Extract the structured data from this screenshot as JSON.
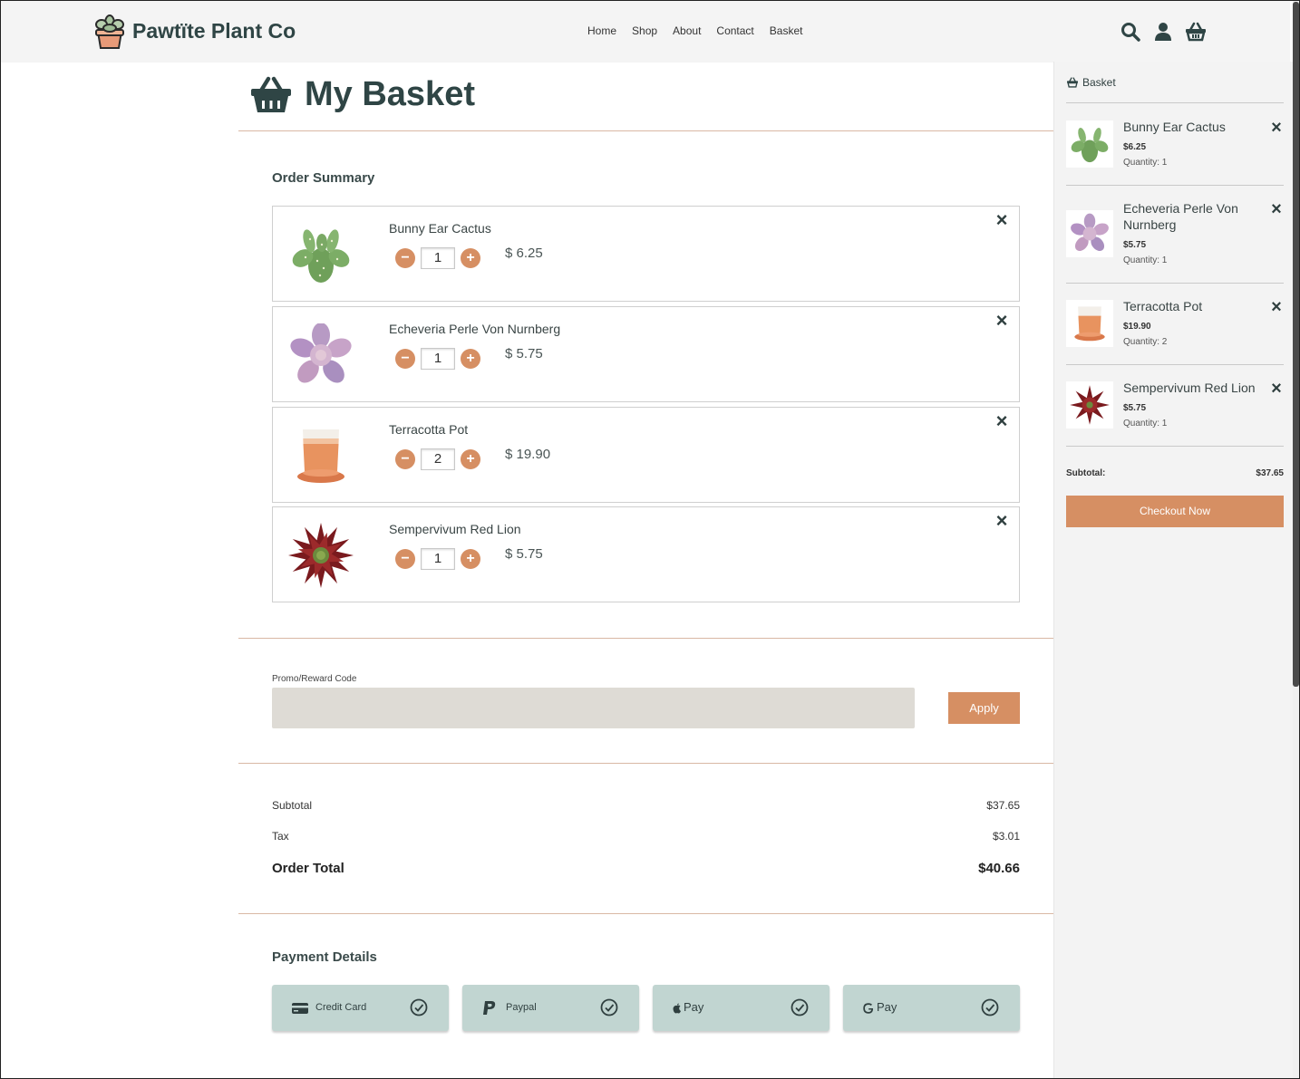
{
  "header": {
    "brand": "Pawtïte Plant Co",
    "nav": [
      "Home",
      "Shop",
      "About",
      "Contact",
      "Basket"
    ],
    "icons": [
      "search-icon",
      "user-icon",
      "basket-icon"
    ]
  },
  "page": {
    "title": "My Basket",
    "order_summary_title": "Order Summary"
  },
  "items": [
    {
      "name": "Bunny Ear Cactus",
      "qty": "1",
      "price": "$ 6.25",
      "image": "bunny-ear-cactus"
    },
    {
      "name": "Echeveria Perle Von Nurnberg",
      "qty": "1",
      "price": "$ 5.75",
      "image": "echeveria"
    },
    {
      "name": "Terracotta Pot",
      "qty": "2",
      "price": "$ 19.90",
      "image": "terracotta-pot"
    },
    {
      "name": "Sempervivum Red Lion",
      "qty": "1",
      "price": "$ 5.75",
      "image": "sempervivum"
    }
  ],
  "promo": {
    "label": "Promo/Reward Code",
    "value": "",
    "apply_label": "Apply"
  },
  "totals": {
    "subtotal_label": "Subtotal",
    "subtotal": "$37.65",
    "tax_label": "Tax",
    "tax": "$3.01",
    "total_label": "Order Total",
    "total": "$40.66"
  },
  "payment": {
    "title": "Payment Details",
    "methods": [
      {
        "label": "Credit Card",
        "icon": "credit-card-icon"
      },
      {
        "label": "Paypal",
        "icon": "paypal-icon"
      },
      {
        "label": "Pay",
        "icon": "apple-icon"
      },
      {
        "label": "Pay",
        "icon": "google-icon"
      }
    ]
  },
  "side_basket": {
    "title": "Basket",
    "items": [
      {
        "name": "Bunny Ear Cactus",
        "price": "$6.25",
        "quantity": "Quantity: 1"
      },
      {
        "name": "Echeveria Perle Von Nurnberg",
        "price": "$5.75",
        "quantity": "Quantity: 1"
      },
      {
        "name": "Terracotta Pot",
        "price": "$19.90",
        "quantity": "Quantity: 2"
      },
      {
        "name": "Sempervivum Red Lion",
        "price": "$5.75",
        "quantity": "Quantity: 1"
      }
    ],
    "subtotal_label": "Subtotal:",
    "subtotal": "$37.65",
    "checkout_label": "Checkout Now"
  },
  "colors": {
    "accent": "#d68f63",
    "dark": "#2f4545",
    "payment_bg": "#c1d5d1",
    "promo_bg": "#dedbd5"
  }
}
